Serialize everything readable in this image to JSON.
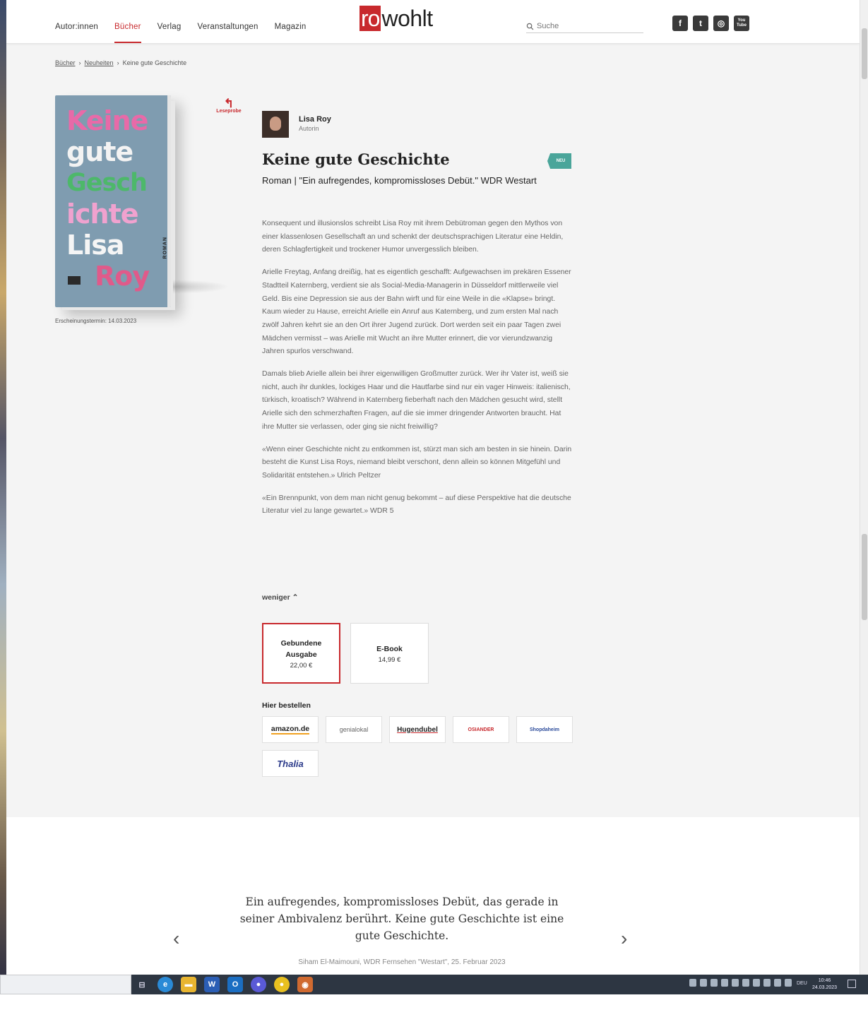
{
  "nav": {
    "items": [
      {
        "label": "Autor:innen"
      },
      {
        "label": "Bücher"
      },
      {
        "label": "Verlag"
      },
      {
        "label": "Veranstaltungen"
      },
      {
        "label": "Magazin"
      }
    ],
    "active": "Bücher"
  },
  "logo": {
    "part1": "ro",
    "part2": "wohlt"
  },
  "search": {
    "placeholder": "Suche"
  },
  "social": [
    "f",
    "t",
    "◎",
    "You Tube"
  ],
  "breadcrumb": {
    "items": [
      "Bücher",
      "Neuheiten"
    ],
    "current": "Keine gute Geschichte"
  },
  "cover": {
    "lines": [
      "Keine",
      "gute",
      "Gesch",
      "ichte",
      "Lisa",
      "Roy"
    ],
    "roman": "ROMAN"
  },
  "release": "Erscheinungstermin: 14.03.2023",
  "leseprobe": "Leseprobe",
  "author": {
    "name": "Lisa Roy",
    "role": "Autorin"
  },
  "book": {
    "title": "Keine gute Geschichte",
    "badge": "NEU",
    "subtitle": "Roman | \"Ein aufregendes, kompromissloses Debüt.\" WDR Westart"
  },
  "description": [
    "Konsequent und illusionslos schreibt Lisa Roy mit ihrem Debütroman gegen den Mythos von einer klassenlosen Gesellschaft an und schenkt der deutschsprachigen Literatur eine Heldin, deren Schlagfertigkeit und trockener Humor unvergesslich bleiben.",
    "Arielle Freytag, Anfang dreißig, hat es eigentlich geschafft: Aufgewachsen im prekären Essener Stadtteil Katernberg, verdient sie als Social-Media-Managerin in Düsseldorf mittlerweile viel Geld. Bis eine Depression sie aus der Bahn wirft und für eine Weile in die «Klapse» bringt. Kaum wieder zu Hause, erreicht Arielle ein Anruf aus Katernberg, und zum ersten Mal nach zwölf Jahren kehrt sie an den Ort ihrer Jugend zurück. Dort werden seit ein paar Tagen zwei Mädchen vermisst – was Arielle mit Wucht an ihre Mutter erinnert, die vor vierundzwanzig Jahren spurlos verschwand.",
    "Damals blieb Arielle allein bei ihrer eigenwilligen Großmutter zurück. Wer ihr Vater ist, weiß sie nicht, auch ihr dunkles, lockiges Haar und die Hautfarbe sind nur ein vager Hinweis: italienisch, türkisch, kroatisch? Während in Katernberg fieberhaft nach den Mädchen gesucht wird, stellt Arielle sich den schmerzhaften Fragen, auf die sie immer dringender Antworten braucht. Hat ihre Mutter sie verlassen, oder ging sie nicht freiwillig?",
    "«Wenn einer Geschichte nicht zu entkommen ist, stürzt man sich am besten in sie hinein. Darin besteht die Kunst Lisa Roys, niemand bleibt verschont, denn allein so können Mitgefühl und Solidarität entstehen.» Ulrich Peltzer",
    "«Ein Brennpunkt, von dem man nicht genug bekommt – auf diese Perspektive hat die deutsche Literatur viel zu lange gewartet.» WDR 5"
  ],
  "less_label": "weniger ⌃",
  "formats": [
    {
      "label": "Gebundene Ausgabe",
      "price": "22,00 €",
      "selected": true
    },
    {
      "label": "E-Book",
      "price": "14,99 €",
      "selected": false
    }
  ],
  "order_label": "Hier bestellen",
  "shops": [
    "amazon.de",
    "genialokal",
    "Hugendubel",
    "OSIANDER",
    "Shopdaheim",
    "Thalia"
  ],
  "quote": {
    "text": "Ein aufregendes, kompromissloses Debüt, das gerade in seiner Ambivalenz berührt. Keine gute Geschichte ist eine gute Geschichte.",
    "source": "Siham El-Maimouni, WDR Fernsehen \"Westart\", 25. Februar 2023"
  },
  "taskbar": {
    "lang": "DEU",
    "time": "10:46",
    "date": "24.03.2023"
  },
  "colors": {
    "accent": "#c8292d",
    "badge": "#4aa59a"
  }
}
